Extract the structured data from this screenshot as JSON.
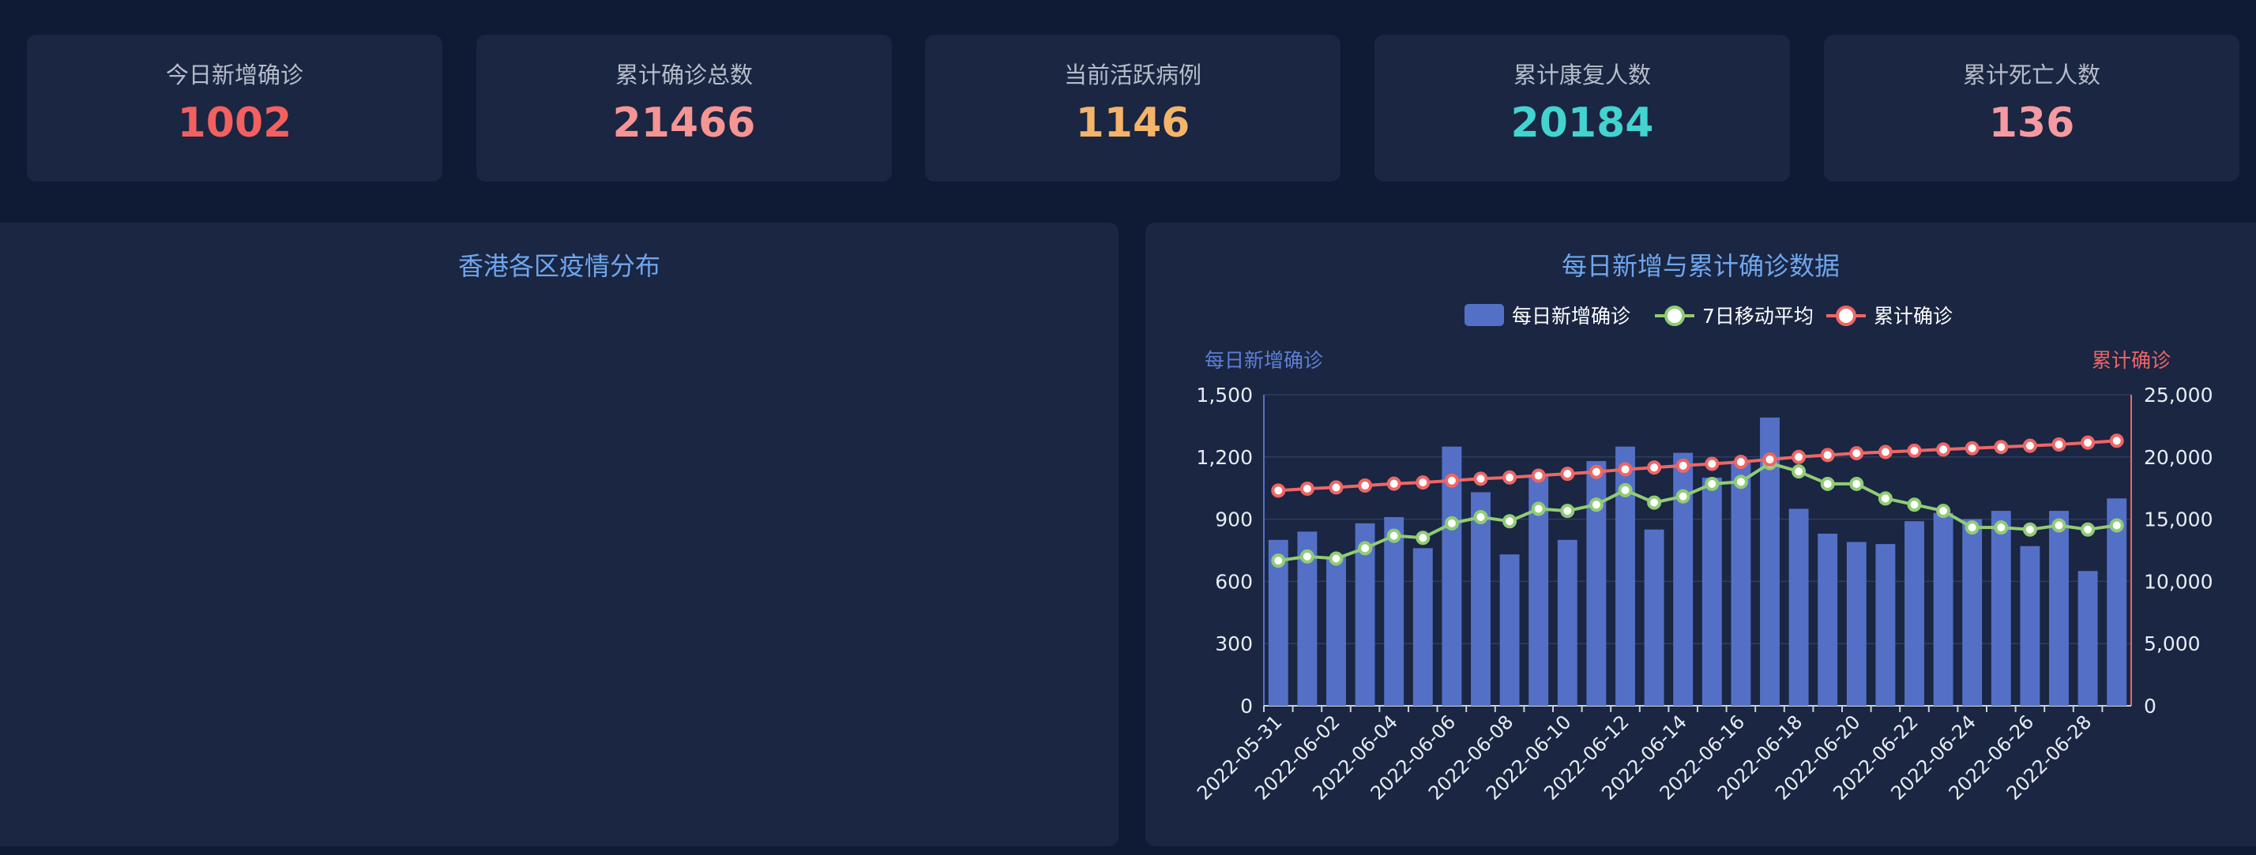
{
  "cards": [
    {
      "label": "今日新增确诊",
      "value": "1002",
      "color": "#f26060"
    },
    {
      "label": "累计确诊总数",
      "value": "21466",
      "color": "#f79494"
    },
    {
      "label": "当前活跃病例",
      "value": "1146",
      "color": "#f4b46a"
    },
    {
      "label": "累计康复人数",
      "value": "20184",
      "color": "#43d3d0"
    },
    {
      "label": "累计死亡人数",
      "value": "136",
      "color": "#f59aa0"
    }
  ],
  "map_panel": {
    "title": "香港各区疫情分布"
  },
  "chart_panel": {
    "title": "每日新增与累计确诊数据"
  },
  "chart_data": {
    "type": "bar",
    "title": "每日新增与累计确诊数据",
    "legend": [
      {
        "name": "每日新增确诊",
        "kind": "bar",
        "color": "#5470c6"
      },
      {
        "name": "7日移动平均",
        "kind": "line",
        "color": "#91cc75"
      },
      {
        "name": "累计确诊",
        "kind": "line",
        "color": "#ee6666"
      }
    ],
    "legend_position": "top-center",
    "ylabel_left": "每日新增确诊",
    "ylabel_right": "累计确诊",
    "ylim_left": [
      0,
      1500
    ],
    "ylim_right": [
      0,
      25000
    ],
    "yticks_left": [
      "0",
      "300",
      "600",
      "900",
      "1,200",
      "1,500"
    ],
    "yticks_right": [
      "0",
      "5,000",
      "10,000",
      "15,000",
      "20,000",
      "25,000"
    ],
    "xtick_labels": [
      "2022-05-31",
      "2022-06-02",
      "2022-06-04",
      "2022-06-06",
      "2022-06-08",
      "2022-06-10",
      "2022-06-12",
      "2022-06-14",
      "2022-06-16",
      "2022-06-18",
      "2022-06-20",
      "2022-06-22",
      "2022-06-24",
      "2022-06-26",
      "2022-06-28"
    ],
    "categories": [
      "2022-05-31",
      "2022-06-01",
      "2022-06-02",
      "2022-06-03",
      "2022-06-04",
      "2022-06-05",
      "2022-06-06",
      "2022-06-07",
      "2022-06-08",
      "2022-06-09",
      "2022-06-10",
      "2022-06-11",
      "2022-06-12",
      "2022-06-13",
      "2022-06-14",
      "2022-06-15",
      "2022-06-16",
      "2022-06-17",
      "2022-06-18",
      "2022-06-19",
      "2022-06-20",
      "2022-06-21",
      "2022-06-22",
      "2022-06-23",
      "2022-06-24",
      "2022-06-25",
      "2022-06-26",
      "2022-06-27",
      "2022-06-28",
      "2022-06-29"
    ],
    "series": [
      {
        "name": "每日新增确诊",
        "axis": "left",
        "type": "bar",
        "values": [
          800,
          840,
          720,
          880,
          910,
          760,
          1250,
          1030,
          730,
          1110,
          800,
          1180,
          1250,
          850,
          1220,
          1100,
          1180,
          1390,
          950,
          830,
          790,
          780,
          890,
          930,
          900,
          940,
          770,
          940,
          650,
          1000
        ]
      },
      {
        "name": "7日移动平均",
        "axis": "left",
        "type": "line",
        "values": [
          700,
          720,
          710,
          760,
          820,
          810,
          880,
          910,
          890,
          950,
          940,
          970,
          1040,
          980,
          1010,
          1070,
          1080,
          1170,
          1130,
          1070,
          1070,
          1000,
          970,
          940,
          860,
          860,
          850,
          870,
          850,
          870
        ]
      },
      {
        "name": "累计确诊",
        "axis": "right",
        "type": "line",
        "values": [
          17300,
          17450,
          17550,
          17700,
          17850,
          17950,
          18100,
          18250,
          18350,
          18500,
          18650,
          18800,
          19000,
          19150,
          19300,
          19450,
          19600,
          19800,
          20000,
          20150,
          20300,
          20400,
          20500,
          20600,
          20700,
          20800,
          20900,
          21000,
          21150,
          21300
        ]
      }
    ]
  }
}
